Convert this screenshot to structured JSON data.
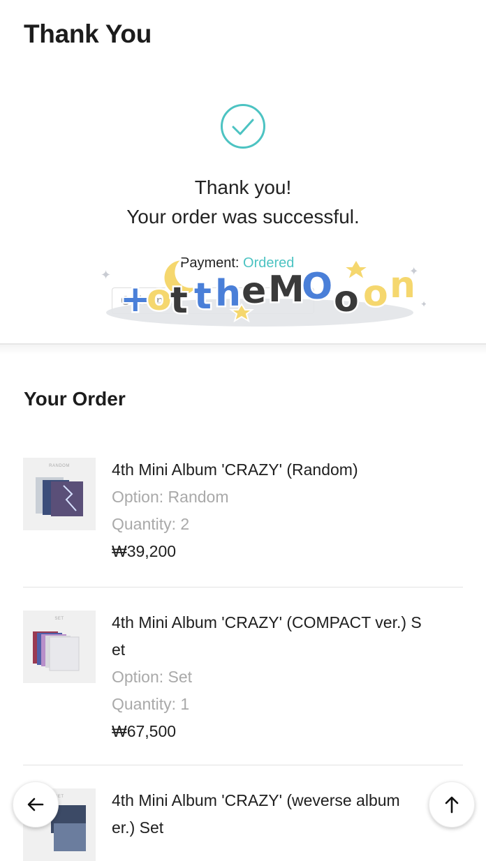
{
  "header": {
    "title": "Thank You"
  },
  "confirmation": {
    "line1": "Thank you!",
    "line2": "Your order was successful.",
    "payment_label": "Payment:",
    "payment_status": "Ordered",
    "order_number_placeholder": "Order no.",
    "sticker_text": "tothemoon",
    "accent_color": "#4cc3c2"
  },
  "order": {
    "section_title": "Your Order",
    "items": [
      {
        "name": "4th Mini Album 'CRAZY' (Random)",
        "name_line2": "",
        "option": "Option: Random",
        "quantity": "Quantity: 2",
        "price": "₩39,200",
        "thumb_label": "RANDOM"
      },
      {
        "name": "4th Mini Album 'CRAZY' (COMPACT ver.) S",
        "name_line2": "et",
        "option": "Option: Set",
        "quantity": "Quantity: 1",
        "price": "₩67,500",
        "thumb_label": "SET"
      },
      {
        "name": "4th Mini Album 'CRAZY' (weverse album",
        "name_line2": "er.) Set",
        "option": "",
        "quantity": "",
        "price": "",
        "thumb_label": "SET"
      }
    ]
  },
  "nav": {
    "back_icon": "arrow-left-icon",
    "top_icon": "arrow-up-icon"
  }
}
